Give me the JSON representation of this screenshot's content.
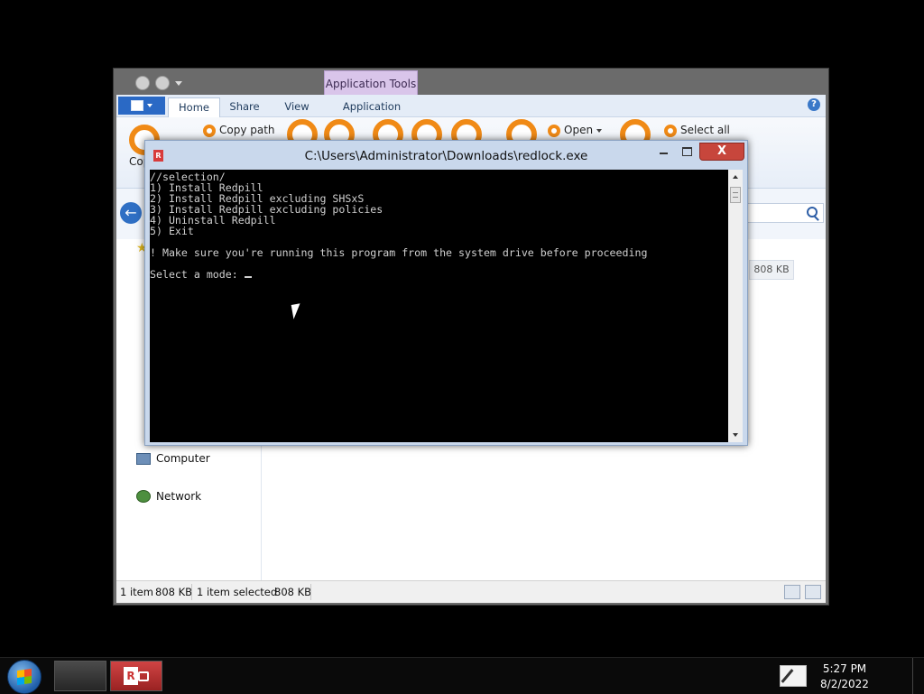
{
  "explorer": {
    "context_tab": "Application Tools",
    "tabs": [
      "Home",
      "Share",
      "View",
      "Application"
    ],
    "ribbon": {
      "copy_path": "Copy path",
      "open": "Open",
      "select_all": "Select all",
      "copy_partial": "Cop"
    },
    "nav": {
      "computer": "Computer",
      "network": "Network"
    },
    "file_size_chip": "808 KB",
    "status": {
      "items": "1 item",
      "items_size": "808 KB",
      "selected": "1 item selected",
      "selected_size": "808 KB"
    }
  },
  "console": {
    "title": "C:\\Users\\Administrator\\Downloads\\redlock.exe",
    "badge": "R",
    "close": "X",
    "lines": [
      "//selection/",
      "1) Install Redpill",
      "2) Install Redpill excluding SHSxS",
      "3) Install Redpill excluding policies",
      "4) Uninstall Redpill",
      "5) Exit",
      "! Make sure you're running this program from the system drive before proceeding",
      "Select a mode: "
    ]
  },
  "taskbar": {
    "task_badge": "R",
    "time": "5:27 PM",
    "date": "8/2/2022"
  },
  "icons": [
    "windows-start-icon",
    "redlock-app-icon",
    "pen-tray-icon",
    "search-icon",
    "back-arrow-icon",
    "star-icon",
    "computer-icon",
    "network-icon"
  ]
}
